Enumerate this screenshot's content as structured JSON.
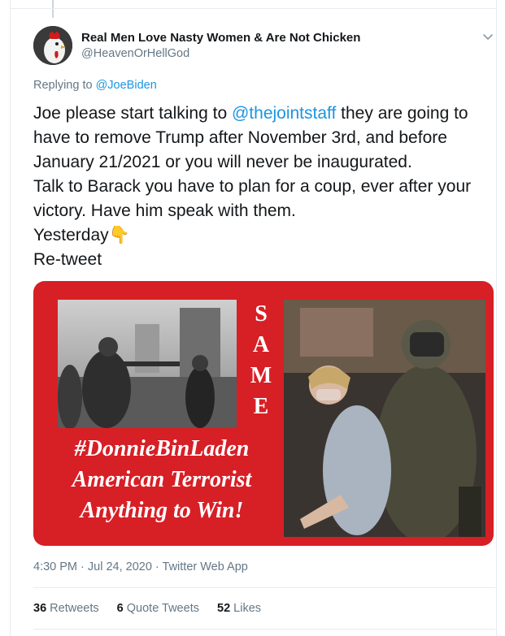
{
  "tweet": {
    "author_name": "Real Men Love Nasty Women & Are Not Chicken",
    "author_handle": "@HeavenOrHellGod",
    "replying_prefix": "Replying to",
    "replying_handle": "@JoeBiden",
    "text_lines": [
      {
        "before": "Joe please start talking to ",
        "mention": "@thejointstaff",
        "after": " they are going to"
      },
      "have to remove Trump after November 3rd, and before",
      "January 21/2021 or you will never be inaugurated.",
      "Talk to Barack you have to plan for a coup, ever after your",
      "victory. Have him speak with them.",
      "Yesterday",
      "Re-tweet"
    ],
    "emoji": "👇",
    "timestamp": "4:30 PM · Jul 24, 2020 · Twitter Web App",
    "stats": {
      "retweets_count": "36",
      "retweets_label": "Retweets",
      "quotes_count": "6",
      "quotes_label": "Quote Tweets",
      "likes_count": "52",
      "likes_label": "Likes"
    }
  },
  "media": {
    "same_letters": [
      "S",
      "A",
      "M",
      "E"
    ],
    "caption_lines": [
      "#DonnieBinLaden",
      "American Terrorist",
      "Anything to Win!"
    ],
    "background_color": "#d71f26"
  },
  "colors": {
    "link": "#1b95e0",
    "secondary_text": "#657786",
    "primary_text": "#14171a"
  }
}
